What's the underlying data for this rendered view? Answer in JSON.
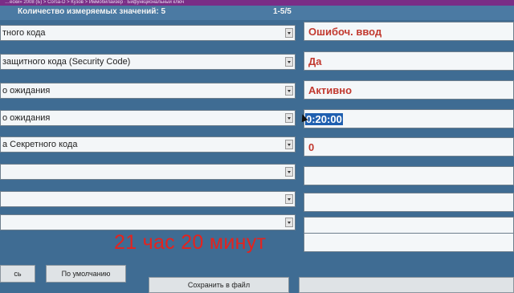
{
  "breadcrumb": "…ески» 2008 (Б) > Corsa-D > Кузов > Иммобилайзер · Бифункциональный ключ",
  "header": {
    "count_label": "Количество измеряемых значений: 5",
    "page_indicator": "1-5/5"
  },
  "rows": [
    {
      "label": "тного кода",
      "value": "Ошибоч. ввод"
    },
    {
      "label": "защитного кода (Security Code)",
      "value": "Да"
    },
    {
      "label": "о ожидания",
      "value": "Активно"
    },
    {
      "label": "о ожидания",
      "value": "0:20:00"
    },
    {
      "label": "а Секретного кода",
      "value": "0"
    },
    {
      "label": "",
      "value": ""
    },
    {
      "label": "",
      "value": ""
    },
    {
      "label": "",
      "value": ""
    },
    {
      "label": "",
      "value": ""
    }
  ],
  "overlay_text": "21 час 20 минут",
  "buttons": {
    "left_partial": "сь",
    "default": "По умолчанию",
    "save_to_file": "Сохранить в файл"
  },
  "icons": {
    "dropdown": "chevron-down-icon",
    "cursor": "mouse-cursor-icon"
  },
  "colors": {
    "background": "#3f6c93",
    "value_text": "#c2392f",
    "selection": "#1f5fb0",
    "overlay_text": "#e5231e",
    "top_strip": "#7a2d86"
  }
}
